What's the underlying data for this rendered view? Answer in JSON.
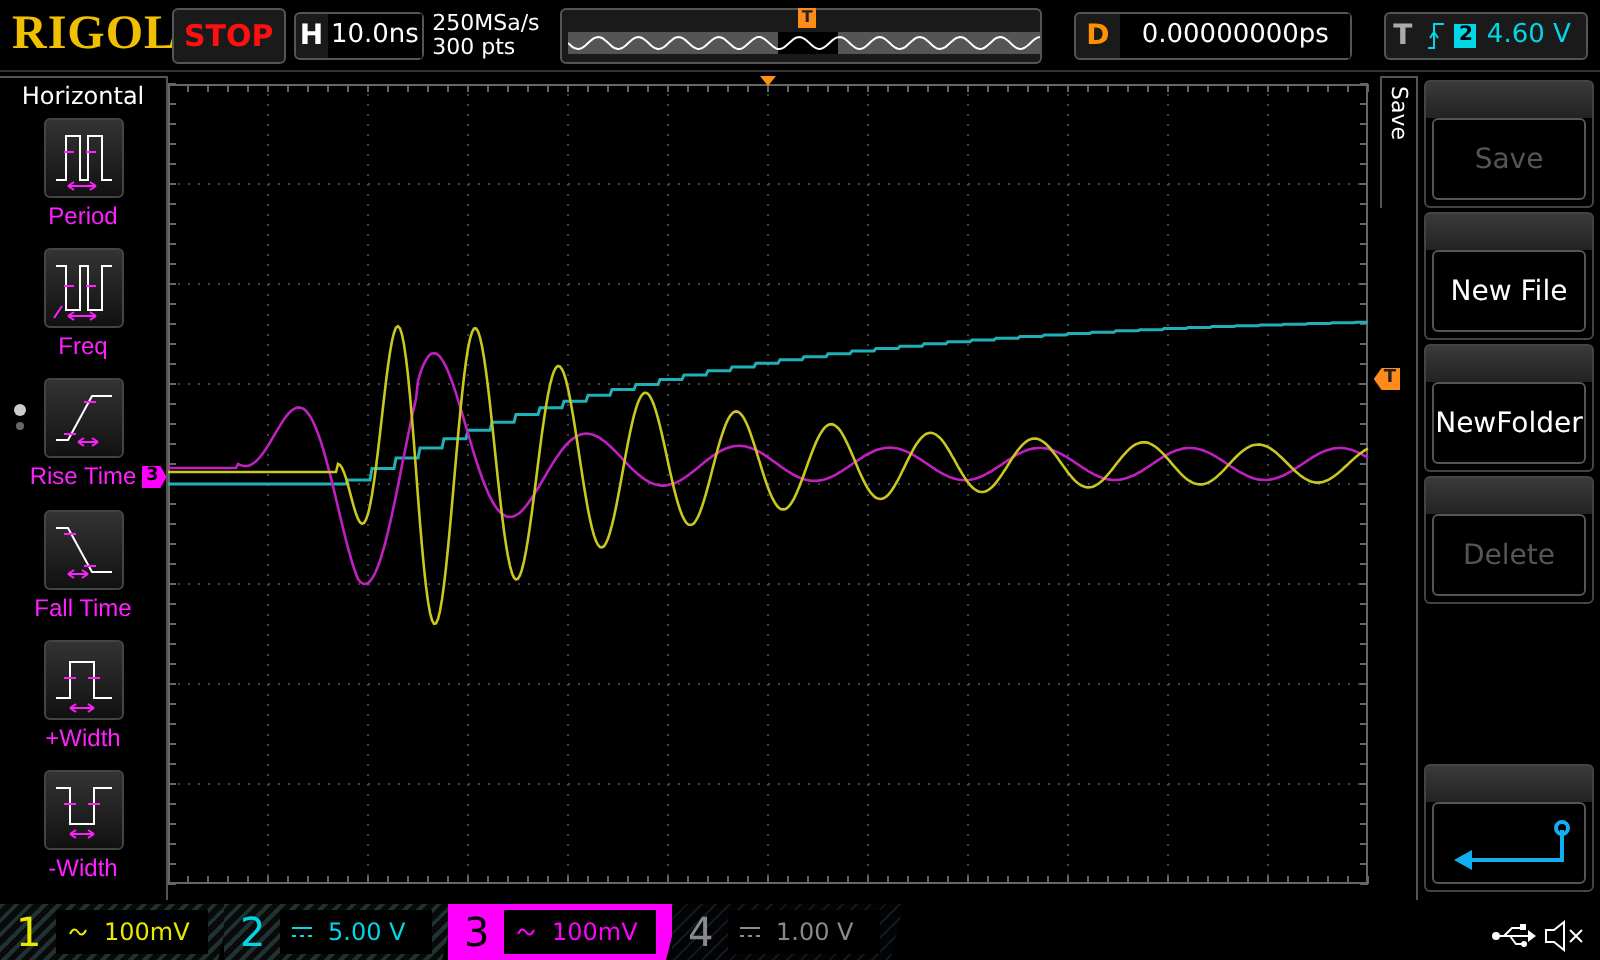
{
  "header": {
    "logo": "RIGOL",
    "run_state": "STOP",
    "horizontal": {
      "label": "H",
      "timebase": "10.0ns"
    },
    "sample_rate": "250MSa/s",
    "memory_depth": "300 pts",
    "overview_marker": "T",
    "delay": {
      "label": "D",
      "value": "0.00000000ps"
    },
    "trigger": {
      "label": "T",
      "kind": "rising_edge",
      "source": "2",
      "level": "4.60 V"
    }
  },
  "measure_menu": {
    "title": "Horizontal",
    "items": [
      {
        "label": "Period",
        "kind": "period"
      },
      {
        "label": "Freq",
        "kind": "freq"
      },
      {
        "label": "Rise Time",
        "kind": "rise"
      },
      {
        "label": "Fall Time",
        "kind": "fall"
      },
      {
        "label": "+Width",
        "kind": "pwidth"
      },
      {
        "label": "-Width",
        "kind": "nwidth"
      }
    ]
  },
  "display": {
    "channel_marker": "3",
    "trigger_marker": "T"
  },
  "save_menu": {
    "title": "Save",
    "buttons": [
      {
        "kind": "text",
        "label": "Save",
        "disabled": true
      },
      {
        "kind": "text",
        "label": "New File",
        "disabled": false
      },
      {
        "kind": "text",
        "label": "NewFolder",
        "disabled": false
      },
      {
        "kind": "text",
        "label": "Delete",
        "disabled": true
      },
      {
        "kind": "back"
      }
    ]
  },
  "channels": [
    {
      "number": "1",
      "kind": "ac",
      "scale": "100mV",
      "color": "#e8e800",
      "enabled": true,
      "selected": false
    },
    {
      "number": "2",
      "kind": "dc",
      "scale": "5.00 V",
      "color": "#00d8e8",
      "enabled": true,
      "selected": false
    },
    {
      "number": "3",
      "kind": "ac",
      "scale": "100mV",
      "color": "#ff00ff",
      "enabled": true,
      "selected": true
    },
    {
      "number": "4",
      "kind": "dc",
      "scale": "1.00 V",
      "color": "#8a8a8a",
      "enabled": false,
      "selected": false
    }
  ]
}
